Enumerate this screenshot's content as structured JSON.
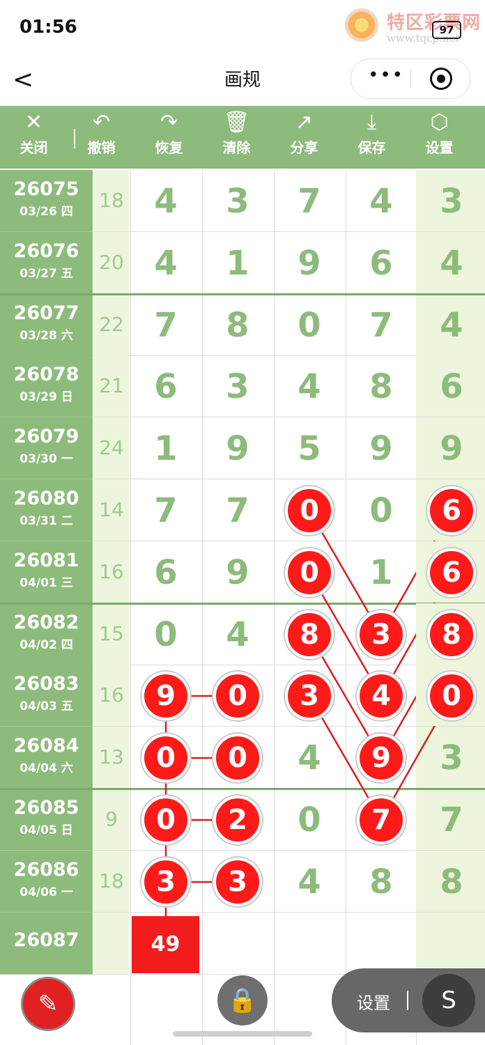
{
  "status_bar": {
    "time": "01:56",
    "battery": "97",
    "watermark_title": "特区彩票网",
    "watermark_url": "www.tqcp.net"
  },
  "nav": {
    "title": "画规",
    "back_label": "<",
    "more_label": "•••"
  },
  "toolbar": [
    {
      "icon": "close-icon",
      "glyph": "✕",
      "label": "关闭"
    },
    {
      "icon": "undo-icon",
      "glyph": "↶",
      "label": "撤销"
    },
    {
      "icon": "redo-icon",
      "glyph": "↷",
      "label": "恢复"
    },
    {
      "icon": "trash-icon",
      "glyph": "🗑",
      "label": "清除"
    },
    {
      "icon": "share-icon",
      "glyph": "↗",
      "label": "分享"
    },
    {
      "icon": "download-icon",
      "glyph": "⤓",
      "label": "保存"
    },
    {
      "icon": "settings-icon",
      "glyph": "⬡",
      "label": "设置"
    }
  ],
  "rows": [
    {
      "issue": "26075",
      "date": "03/26 四",
      "sum": "18",
      "digits": [
        "4",
        "3",
        "7",
        "4",
        "3"
      ]
    },
    {
      "issue": "26076",
      "date": "03/27 五",
      "sum": "20",
      "digits": [
        "4",
        "1",
        "9",
        "6",
        "4"
      ]
    },
    {
      "issue": "26077",
      "date": "03/28 六",
      "sum": "22",
      "digits": [
        "7",
        "8",
        "0",
        "7",
        "4"
      ]
    },
    {
      "issue": "26078",
      "date": "03/29 日",
      "sum": "21",
      "digits": [
        "6",
        "3",
        "4",
        "8",
        "6"
      ]
    },
    {
      "issue": "26079",
      "date": "03/30 一",
      "sum": "24",
      "digits": [
        "1",
        "9",
        "5",
        "9",
        "9"
      ]
    },
    {
      "issue": "26080",
      "date": "03/31 二",
      "sum": "14",
      "digits": [
        "7",
        "7",
        "0",
        "0",
        "6"
      ]
    },
    {
      "issue": "26081",
      "date": "04/01 三",
      "sum": "16",
      "digits": [
        "6",
        "9",
        "0",
        "1",
        "6"
      ]
    },
    {
      "issue": "26082",
      "date": "04/02 四",
      "sum": "15",
      "digits": [
        "0",
        "4",
        "8",
        "3",
        "8"
      ]
    },
    {
      "issue": "26083",
      "date": "04/03 五",
      "sum": "16",
      "digits": [
        "9",
        "0",
        "3",
        "4",
        "0"
      ]
    },
    {
      "issue": "26084",
      "date": "04/04 六",
      "sum": "13",
      "digits": [
        "0",
        "0",
        "4",
        "9",
        "3"
      ]
    },
    {
      "issue": "26085",
      "date": "04/05 日",
      "sum": "9",
      "digits": [
        "0",
        "2",
        "0",
        "7",
        "7"
      ]
    },
    {
      "issue": "26086",
      "date": "04/06 一",
      "sum": "18",
      "digits": [
        "3",
        "3",
        "4",
        "8",
        "8"
      ]
    },
    {
      "issue": "26087",
      "date": "",
      "sum": "",
      "digits": [
        "",
        "",
        "",
        "",
        ""
      ]
    }
  ],
  "highlights": [
    [
      5,
      2
    ],
    [
      5,
      4
    ],
    [
      6,
      2
    ],
    [
      6,
      4
    ],
    [
      7,
      2
    ],
    [
      7,
      3
    ],
    [
      7,
      4
    ],
    [
      8,
      0
    ],
    [
      8,
      1
    ],
    [
      8,
      2
    ],
    [
      8,
      3
    ],
    [
      8,
      4
    ],
    [
      9,
      0
    ],
    [
      9,
      1
    ],
    [
      9,
      3
    ],
    [
      10,
      0
    ],
    [
      10,
      1
    ],
    [
      10,
      3
    ],
    [
      11,
      0
    ],
    [
      11,
      1
    ]
  ],
  "lines": [
    [
      [
        5,
        2
      ],
      [
        7,
        3
      ]
    ],
    [
      [
        5,
        4
      ],
      [
        7,
        3
      ]
    ],
    [
      [
        6,
        2
      ],
      [
        8,
        3
      ]
    ],
    [
      [
        6,
        4
      ],
      [
        8,
        3
      ]
    ],
    [
      [
        7,
        2
      ],
      [
        9,
        3
      ]
    ],
    [
      [
        7,
        4
      ],
      [
        9,
        3
      ]
    ],
    [
      [
        8,
        2
      ],
      [
        10,
        3
      ]
    ],
    [
      [
        8,
        4
      ],
      [
        10,
        3
      ]
    ],
    [
      [
        8,
        0
      ],
      [
        8,
        1
      ]
    ],
    [
      [
        9,
        0
      ],
      [
        9,
        1
      ]
    ],
    [
      [
        10,
        0
      ],
      [
        10,
        1
      ]
    ],
    [
      [
        11,
        0
      ],
      [
        11,
        1
      ]
    ],
    [
      [
        8,
        0
      ],
      [
        11,
        0
      ]
    ]
  ],
  "result_box": {
    "value": "49"
  },
  "bottom": {
    "settings_label": "设置",
    "s_glyph": "S",
    "pen_glyph": "✎",
    "lock_glyph": "🔒"
  },
  "colors": {
    "green": "#8dbb7b",
    "light_green": "#edf6dc",
    "red": "#ff1a1a",
    "line_red": "#d32020"
  }
}
